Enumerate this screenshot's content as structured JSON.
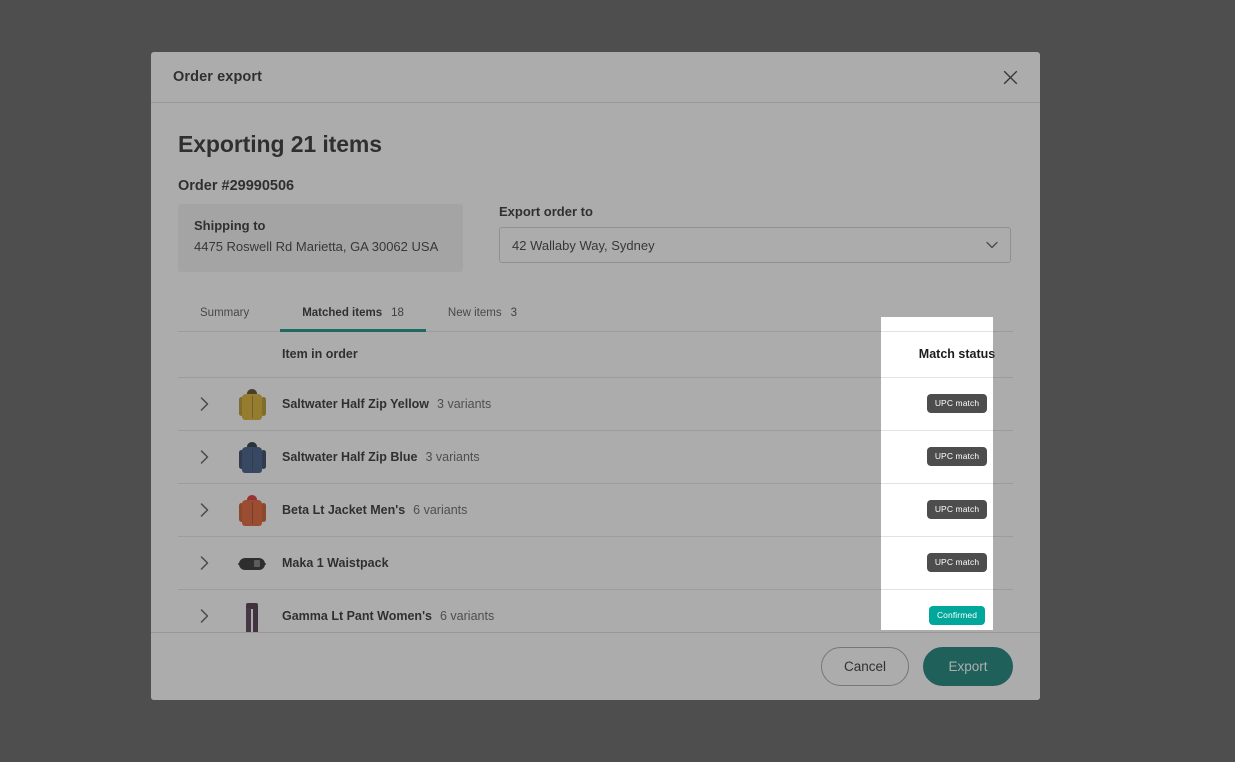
{
  "window": {
    "title": "Order export",
    "close_icon": "close-icon"
  },
  "main": {
    "headline": "Exporting 21 items",
    "order_number": "Order #29990506",
    "shipping": {
      "label": "Shipping to",
      "address": "4475 Roswell Rd Marietta, GA 30062 USA"
    },
    "export_to": {
      "label": "Export order to",
      "selected": "42 Wallaby Way, Sydney",
      "chevron_icon": "chevron-down-icon"
    },
    "tabs": [
      {
        "label": "Summary",
        "count": "",
        "active": false
      },
      {
        "label": "Matched items",
        "count": "18",
        "active": true
      },
      {
        "label": "New items",
        "count": "3",
        "active": false
      }
    ],
    "table": {
      "headers": {
        "item": "Item in order",
        "status": "Match status"
      },
      "rows": [
        {
          "expand_icon": "chevron-right-icon",
          "thumb": "jacket-yellow",
          "name": "Saltwater Half Zip Yellow",
          "variants": "3 variants",
          "status": "UPC match",
          "status_style": "dark"
        },
        {
          "expand_icon": "chevron-right-icon",
          "thumb": "jacket-blue",
          "name": "Saltwater Half Zip Blue",
          "variants": "3 variants",
          "status": "UPC match",
          "status_style": "dark"
        },
        {
          "expand_icon": "chevron-right-icon",
          "thumb": "jacket-red",
          "name": "Beta Lt Jacket Men's",
          "variants": "6 variants",
          "status": "UPC match",
          "status_style": "dark"
        },
        {
          "expand_icon": "chevron-right-icon",
          "thumb": "waistpack-black",
          "name": "Maka 1 Waistpack",
          "variants": "",
          "status": "UPC match",
          "status_style": "dark"
        },
        {
          "expand_icon": "chevron-right-icon",
          "thumb": "pants-purple",
          "name": "Gamma Lt Pant Women's",
          "variants": "6 variants",
          "status": "Confirmed",
          "status_style": "teal"
        }
      ]
    }
  },
  "footer": {
    "cancel_label": "Cancel",
    "export_label": "Export"
  },
  "colors": {
    "accent_teal": "#00857a",
    "export_button": "#00756b",
    "confirmed_badge": "#00a79a",
    "match_badge": "#4d4d4d",
    "page_background": "#545454"
  }
}
